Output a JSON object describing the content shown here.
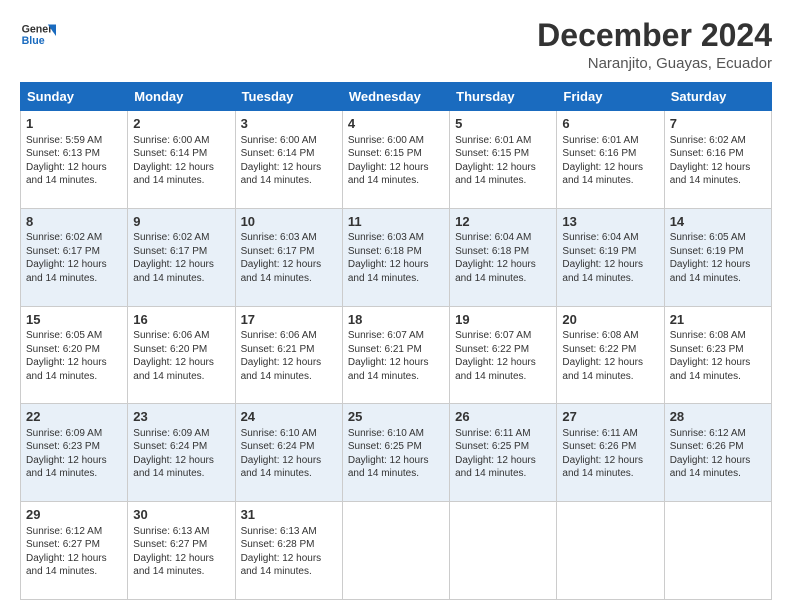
{
  "logo": {
    "line1": "General",
    "line2": "Blue"
  },
  "title": "December 2024",
  "subtitle": "Naranjito, Guayas, Ecuador",
  "calendar": {
    "headers": [
      "Sunday",
      "Monday",
      "Tuesday",
      "Wednesday",
      "Thursday",
      "Friday",
      "Saturday"
    ],
    "weeks": [
      [
        {
          "day": "1",
          "sunrise": "5:59 AM",
          "sunset": "6:13 PM",
          "daylight": "12 hours and 14 minutes."
        },
        {
          "day": "2",
          "sunrise": "6:00 AM",
          "sunset": "6:14 PM",
          "daylight": "12 hours and 14 minutes."
        },
        {
          "day": "3",
          "sunrise": "6:00 AM",
          "sunset": "6:14 PM",
          "daylight": "12 hours and 14 minutes."
        },
        {
          "day": "4",
          "sunrise": "6:00 AM",
          "sunset": "6:15 PM",
          "daylight": "12 hours and 14 minutes."
        },
        {
          "day": "5",
          "sunrise": "6:01 AM",
          "sunset": "6:15 PM",
          "daylight": "12 hours and 14 minutes."
        },
        {
          "day": "6",
          "sunrise": "6:01 AM",
          "sunset": "6:16 PM",
          "daylight": "12 hours and 14 minutes."
        },
        {
          "day": "7",
          "sunrise": "6:02 AM",
          "sunset": "6:16 PM",
          "daylight": "12 hours and 14 minutes."
        }
      ],
      [
        {
          "day": "8",
          "sunrise": "6:02 AM",
          "sunset": "6:17 PM",
          "daylight": "12 hours and 14 minutes."
        },
        {
          "day": "9",
          "sunrise": "6:02 AM",
          "sunset": "6:17 PM",
          "daylight": "12 hours and 14 minutes."
        },
        {
          "day": "10",
          "sunrise": "6:03 AM",
          "sunset": "6:17 PM",
          "daylight": "12 hours and 14 minutes."
        },
        {
          "day": "11",
          "sunrise": "6:03 AM",
          "sunset": "6:18 PM",
          "daylight": "12 hours and 14 minutes."
        },
        {
          "day": "12",
          "sunrise": "6:04 AM",
          "sunset": "6:18 PM",
          "daylight": "12 hours and 14 minutes."
        },
        {
          "day": "13",
          "sunrise": "6:04 AM",
          "sunset": "6:19 PM",
          "daylight": "12 hours and 14 minutes."
        },
        {
          "day": "14",
          "sunrise": "6:05 AM",
          "sunset": "6:19 PM",
          "daylight": "12 hours and 14 minutes."
        }
      ],
      [
        {
          "day": "15",
          "sunrise": "6:05 AM",
          "sunset": "6:20 PM",
          "daylight": "12 hours and 14 minutes."
        },
        {
          "day": "16",
          "sunrise": "6:06 AM",
          "sunset": "6:20 PM",
          "daylight": "12 hours and 14 minutes."
        },
        {
          "day": "17",
          "sunrise": "6:06 AM",
          "sunset": "6:21 PM",
          "daylight": "12 hours and 14 minutes."
        },
        {
          "day": "18",
          "sunrise": "6:07 AM",
          "sunset": "6:21 PM",
          "daylight": "12 hours and 14 minutes."
        },
        {
          "day": "19",
          "sunrise": "6:07 AM",
          "sunset": "6:22 PM",
          "daylight": "12 hours and 14 minutes."
        },
        {
          "day": "20",
          "sunrise": "6:08 AM",
          "sunset": "6:22 PM",
          "daylight": "12 hours and 14 minutes."
        },
        {
          "day": "21",
          "sunrise": "6:08 AM",
          "sunset": "6:23 PM",
          "daylight": "12 hours and 14 minutes."
        }
      ],
      [
        {
          "day": "22",
          "sunrise": "6:09 AM",
          "sunset": "6:23 PM",
          "daylight": "12 hours and 14 minutes."
        },
        {
          "day": "23",
          "sunrise": "6:09 AM",
          "sunset": "6:24 PM",
          "daylight": "12 hours and 14 minutes."
        },
        {
          "day": "24",
          "sunrise": "6:10 AM",
          "sunset": "6:24 PM",
          "daylight": "12 hours and 14 minutes."
        },
        {
          "day": "25",
          "sunrise": "6:10 AM",
          "sunset": "6:25 PM",
          "daylight": "12 hours and 14 minutes."
        },
        {
          "day": "26",
          "sunrise": "6:11 AM",
          "sunset": "6:25 PM",
          "daylight": "12 hours and 14 minutes."
        },
        {
          "day": "27",
          "sunrise": "6:11 AM",
          "sunset": "6:26 PM",
          "daylight": "12 hours and 14 minutes."
        },
        {
          "day": "28",
          "sunrise": "6:12 AM",
          "sunset": "6:26 PM",
          "daylight": "12 hours and 14 minutes."
        }
      ],
      [
        {
          "day": "29",
          "sunrise": "6:12 AM",
          "sunset": "6:27 PM",
          "daylight": "12 hours and 14 minutes."
        },
        {
          "day": "30",
          "sunrise": "6:13 AM",
          "sunset": "6:27 PM",
          "daylight": "12 hours and 14 minutes."
        },
        {
          "day": "31",
          "sunrise": "6:13 AM",
          "sunset": "6:28 PM",
          "daylight": "12 hours and 14 minutes."
        },
        null,
        null,
        null,
        null
      ]
    ],
    "labels": {
      "sunrise": "Sunrise:",
      "sunset": "Sunset:",
      "daylight": "Daylight:"
    }
  }
}
